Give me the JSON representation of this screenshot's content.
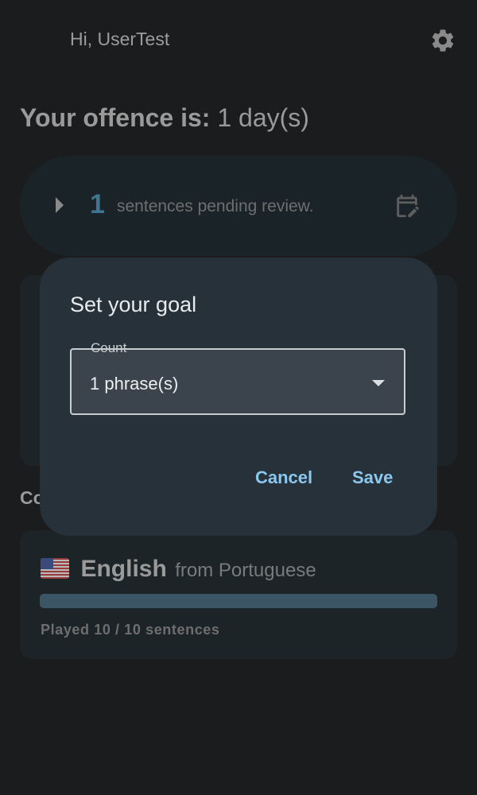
{
  "header": {
    "greeting": "Hi, UserTest",
    "settings_icon": "gear-icon"
  },
  "offence": {
    "label": "Your offence is:",
    "value": "1 day(s)"
  },
  "pending": {
    "count": "1",
    "text": "sentences pending review.",
    "expand_icon": "play-arrow-icon",
    "action_icon": "calendar-edit-icon",
    "count_color": "#3e7590"
  },
  "section": {
    "label_partial": "Co"
  },
  "course": {
    "flag": "us-flag-icon",
    "language": "English",
    "from_text": "from Portuguese",
    "progress_fraction": 1.0,
    "played_text": "Played 10 / 10 sentences"
  },
  "dialog": {
    "title": "Set your goal",
    "field_label": "Count",
    "field_value": "1 phrase(s)",
    "cancel_label": "Cancel",
    "save_label": "Save",
    "accent_color": "#8bc8f0"
  }
}
